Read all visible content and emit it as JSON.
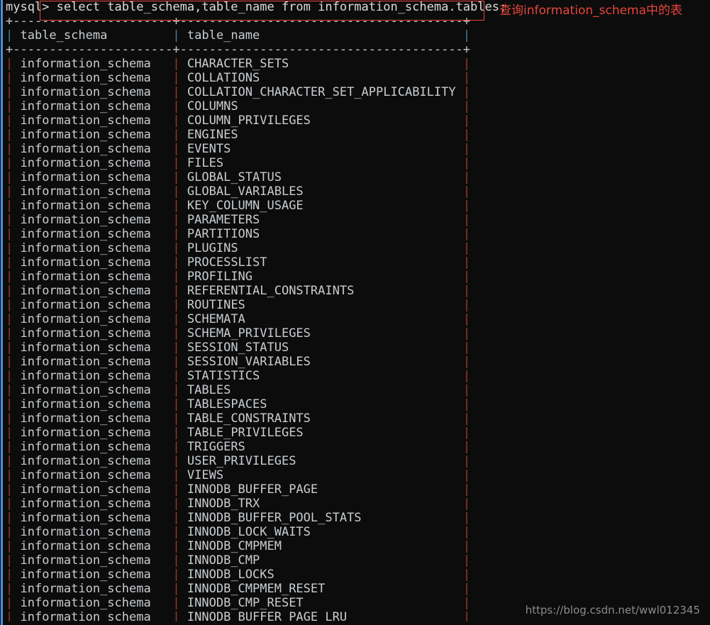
{
  "window": {
    "kind": "terminal",
    "background_color": "#0c0c0c",
    "text_color": "#cccccc",
    "scrollbar_color": "#4a90d9"
  },
  "prompt": {
    "text": "mysql>",
    "color": "#dcdcdc"
  },
  "query": {
    "sql": "select table_schema,table_name from information_schema.tables;",
    "highlight_box_color": "#e8453c"
  },
  "annotation": {
    "text": "查询information_schema中的表",
    "color": "#e8453c"
  },
  "watermark": {
    "text": "https://blog.csdn.net/wwl012345",
    "color": "#8c8c8c"
  },
  "result_table": {
    "top_rule": "+--------------------+-------------------------------------+",
    "header_rule": "+--------------------+-------------------------------------+",
    "columns": [
      {
        "name": "table_schema",
        "width": 20
      },
      {
        "name": "table_name",
        "width": 37
      }
    ],
    "header_line": "| table_schema       | table_name                          |",
    "pipe_color_header": "#3e7fa6",
    "pipe_color_body": "#9c3b22",
    "rule_color": "#c8c8c8",
    "rows": [
      {
        "table_schema": "information_schema",
        "table_name": "CHARACTER_SETS"
      },
      {
        "table_schema": "information_schema",
        "table_name": "COLLATIONS"
      },
      {
        "table_schema": "information_schema",
        "table_name": "COLLATION_CHARACTER_SET_APPLICABILITY"
      },
      {
        "table_schema": "information_schema",
        "table_name": "COLUMNS"
      },
      {
        "table_schema": "information_schema",
        "table_name": "COLUMN_PRIVILEGES"
      },
      {
        "table_schema": "information_schema",
        "table_name": "ENGINES"
      },
      {
        "table_schema": "information_schema",
        "table_name": "EVENTS"
      },
      {
        "table_schema": "information_schema",
        "table_name": "FILES"
      },
      {
        "table_schema": "information_schema",
        "table_name": "GLOBAL_STATUS"
      },
      {
        "table_schema": "information_schema",
        "table_name": "GLOBAL_VARIABLES"
      },
      {
        "table_schema": "information_schema",
        "table_name": "KEY_COLUMN_USAGE"
      },
      {
        "table_schema": "information_schema",
        "table_name": "PARAMETERS"
      },
      {
        "table_schema": "information_schema",
        "table_name": "PARTITIONS"
      },
      {
        "table_schema": "information_schema",
        "table_name": "PLUGINS"
      },
      {
        "table_schema": "information_schema",
        "table_name": "PROCESSLIST"
      },
      {
        "table_schema": "information_schema",
        "table_name": "PROFILING"
      },
      {
        "table_schema": "information_schema",
        "table_name": "REFERENTIAL_CONSTRAINTS"
      },
      {
        "table_schema": "information_schema",
        "table_name": "ROUTINES"
      },
      {
        "table_schema": "information_schema",
        "table_name": "SCHEMATA"
      },
      {
        "table_schema": "information_schema",
        "table_name": "SCHEMA_PRIVILEGES"
      },
      {
        "table_schema": "information_schema",
        "table_name": "SESSION_STATUS"
      },
      {
        "table_schema": "information_schema",
        "table_name": "SESSION_VARIABLES"
      },
      {
        "table_schema": "information_schema",
        "table_name": "STATISTICS"
      },
      {
        "table_schema": "information_schema",
        "table_name": "TABLES"
      },
      {
        "table_schema": "information_schema",
        "table_name": "TABLESPACES"
      },
      {
        "table_schema": "information_schema",
        "table_name": "TABLE_CONSTRAINTS"
      },
      {
        "table_schema": "information_schema",
        "table_name": "TABLE_PRIVILEGES"
      },
      {
        "table_schema": "information_schema",
        "table_name": "TRIGGERS"
      },
      {
        "table_schema": "information_schema",
        "table_name": "USER_PRIVILEGES"
      },
      {
        "table_schema": "information_schema",
        "table_name": "VIEWS"
      },
      {
        "table_schema": "information_schema",
        "table_name": "INNODB_BUFFER_PAGE"
      },
      {
        "table_schema": "information_schema",
        "table_name": "INNODB_TRX"
      },
      {
        "table_schema": "information_schema",
        "table_name": "INNODB_BUFFER_POOL_STATS"
      },
      {
        "table_schema": "information_schema",
        "table_name": "INNODB_LOCK_WAITS"
      },
      {
        "table_schema": "information_schema",
        "table_name": "INNODB_CMPMEM"
      },
      {
        "table_schema": "information_schema",
        "table_name": "INNODB_CMP"
      },
      {
        "table_schema": "information_schema",
        "table_name": "INNODB_LOCKS"
      },
      {
        "table_schema": "information_schema",
        "table_name": "INNODB_CMPMEM_RESET"
      },
      {
        "table_schema": "information_schema",
        "table_name": "INNODB_CMP_RESET"
      },
      {
        "table_schema": "information_schema",
        "table_name": "INNODB_BUFFER_PAGE_LRU"
      }
    ]
  }
}
